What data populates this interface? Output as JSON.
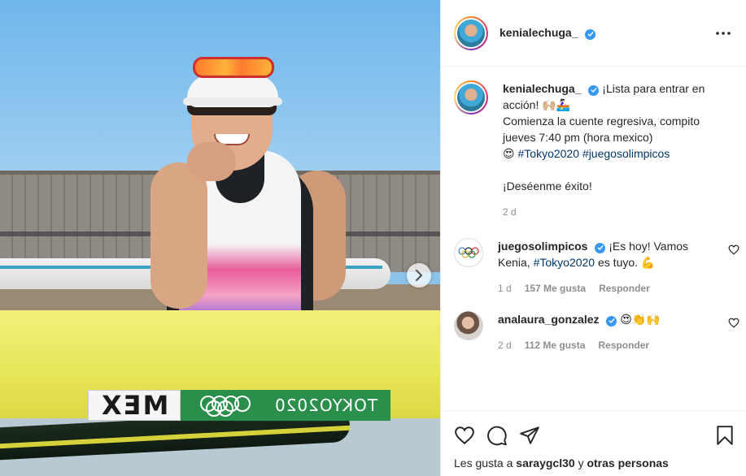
{
  "post": {
    "image_overlay": {
      "boat_code": "MEX",
      "games_label": "TOKYO2020"
    }
  },
  "header": {
    "username": "kenialechuga_",
    "verified": true
  },
  "caption": {
    "username": "kenialechuga_",
    "line1": "¡Lista para entrar en acción! 🙌🏼🚣🏻‍♀️",
    "line2": "Comienza la cuente regresiva, compito jueves 7:40 pm (hora mexico)",
    "emoji": "😍",
    "hashtag1": "#Tokyo2020",
    "hashtag2": "#juegosolimpicos",
    "line3": "¡Deséenme éxito!",
    "time": "2 d"
  },
  "comments": [
    {
      "username": "juegosolimpicos",
      "text_a": "¡Es hoy! Vamos Kenia, ",
      "hashtag": "#Tokyo2020",
      "text_b": " es tuyo. 💪",
      "time": "1 d",
      "likes": "157 Me gusta",
      "reply": "Responder"
    },
    {
      "username": "analaura_gonzalez",
      "text": "😍👏🙌",
      "time": "2 d",
      "likes": "112 Me gusta",
      "reply": "Responder"
    }
  ],
  "footer": {
    "likes_prefix": "Les gusta a ",
    "liker": "saraygcl30",
    "likes_middle": " y ",
    "others": "otras personas"
  },
  "colors": {
    "verified": "#3897f0",
    "hashtag": "#00376b",
    "muted": "#8e8e8e",
    "border": "#efefef"
  }
}
